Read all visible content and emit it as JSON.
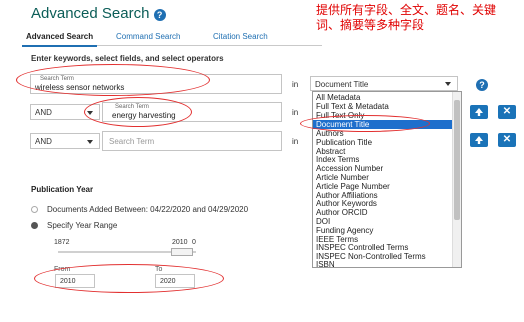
{
  "header": {
    "title": "Advanced Search",
    "help_icon": "?",
    "annotation_text": "提供所有字段、全文、题名、关键词、摘要等多种字段"
  },
  "tabs": [
    {
      "label": "Advanced Search",
      "active": true
    },
    {
      "label": "Command Search",
      "active": false
    },
    {
      "label": "Citation Search",
      "active": false
    }
  ],
  "instruction": "Enter keywords, select fields, and select operators",
  "rows": [
    {
      "label": "Search Term",
      "value": "wireless sensor networks",
      "in": "in",
      "field": "Document Title"
    },
    {
      "operator": "AND",
      "label": "Search Term",
      "value": "energy harvesting",
      "in": "in"
    },
    {
      "operator": "AND",
      "placeholder": "Search Term",
      "in": "in"
    }
  ],
  "dropdown_options": [
    "All Metadata",
    "Full Text & Metadata",
    "Full Text Only",
    "Document Title",
    "Authors",
    "Publication Title",
    "Abstract",
    "Index Terms",
    "Accession Number",
    "Article Number",
    "Article Page Number",
    "Author Affiliations",
    "Author Keywords",
    "Author ORCID",
    "DOI",
    "Funding Agency",
    "IEEE Terms",
    "INSPEC Controlled Terms",
    "INSPEC Non-Controlled Terms",
    "ISBN"
  ],
  "selected_option": "Document Title",
  "buttons": {
    "add": "+",
    "remove": "✕"
  },
  "publication_year": {
    "heading": "Publication Year",
    "option_added": "Documents Added Between: 04/22/2020 and 04/29/2020",
    "option_range": "Specify Year Range",
    "selected": "range",
    "slider_min": "1872",
    "slider_max": "2010",
    "slider_extra": "0",
    "from_label": "From",
    "to_label": "To",
    "from_value": "2010",
    "to_value": "2020"
  },
  "colors": {
    "accent": "#1f6fb2",
    "highlight": "#1e6fcc",
    "annotation": "#e00000",
    "title": "#0b5d57"
  }
}
